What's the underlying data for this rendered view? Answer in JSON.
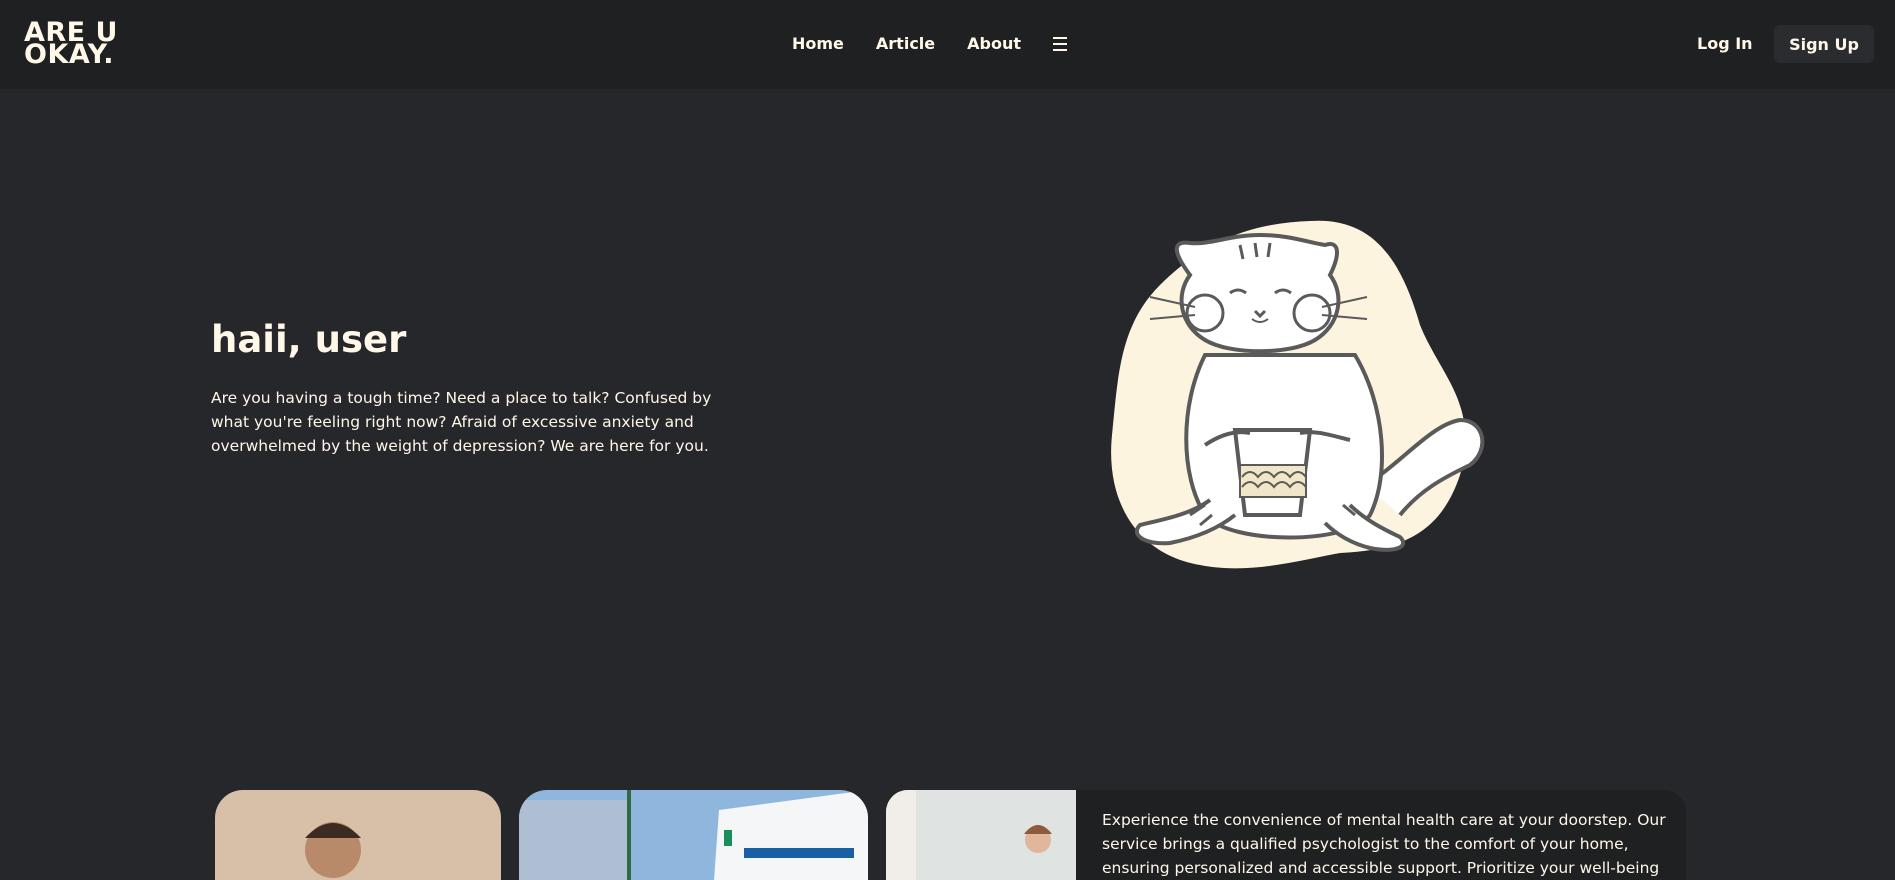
{
  "header": {
    "logo_line1": "ARE U",
    "logo_line2": "OKAY.",
    "nav": [
      "Home",
      "Article",
      "About"
    ],
    "menu_icon": "hamburger-icon",
    "login": "Log In",
    "signup": "Sign Up"
  },
  "hero": {
    "title": "haii, user",
    "text": "Are you having a tough time? Need a place to talk? Confused by what you're feeling right now? Afraid of excessive anxiety and overwhelmed by the weight of depression? We are here for you.",
    "illustration": "cat-holding-cup-illustration"
  },
  "service": {
    "text": "Experience the convenience of mental health care at your doorstep. Our service brings a qualified psychologist to the comfort of your home, ensuring personalized and accessible support. Prioritize your well-being with in-home"
  },
  "colors": {
    "background": "#26272a",
    "header": "#1f2022",
    "text": "#fff7e8",
    "blob": "#fdf4df"
  }
}
